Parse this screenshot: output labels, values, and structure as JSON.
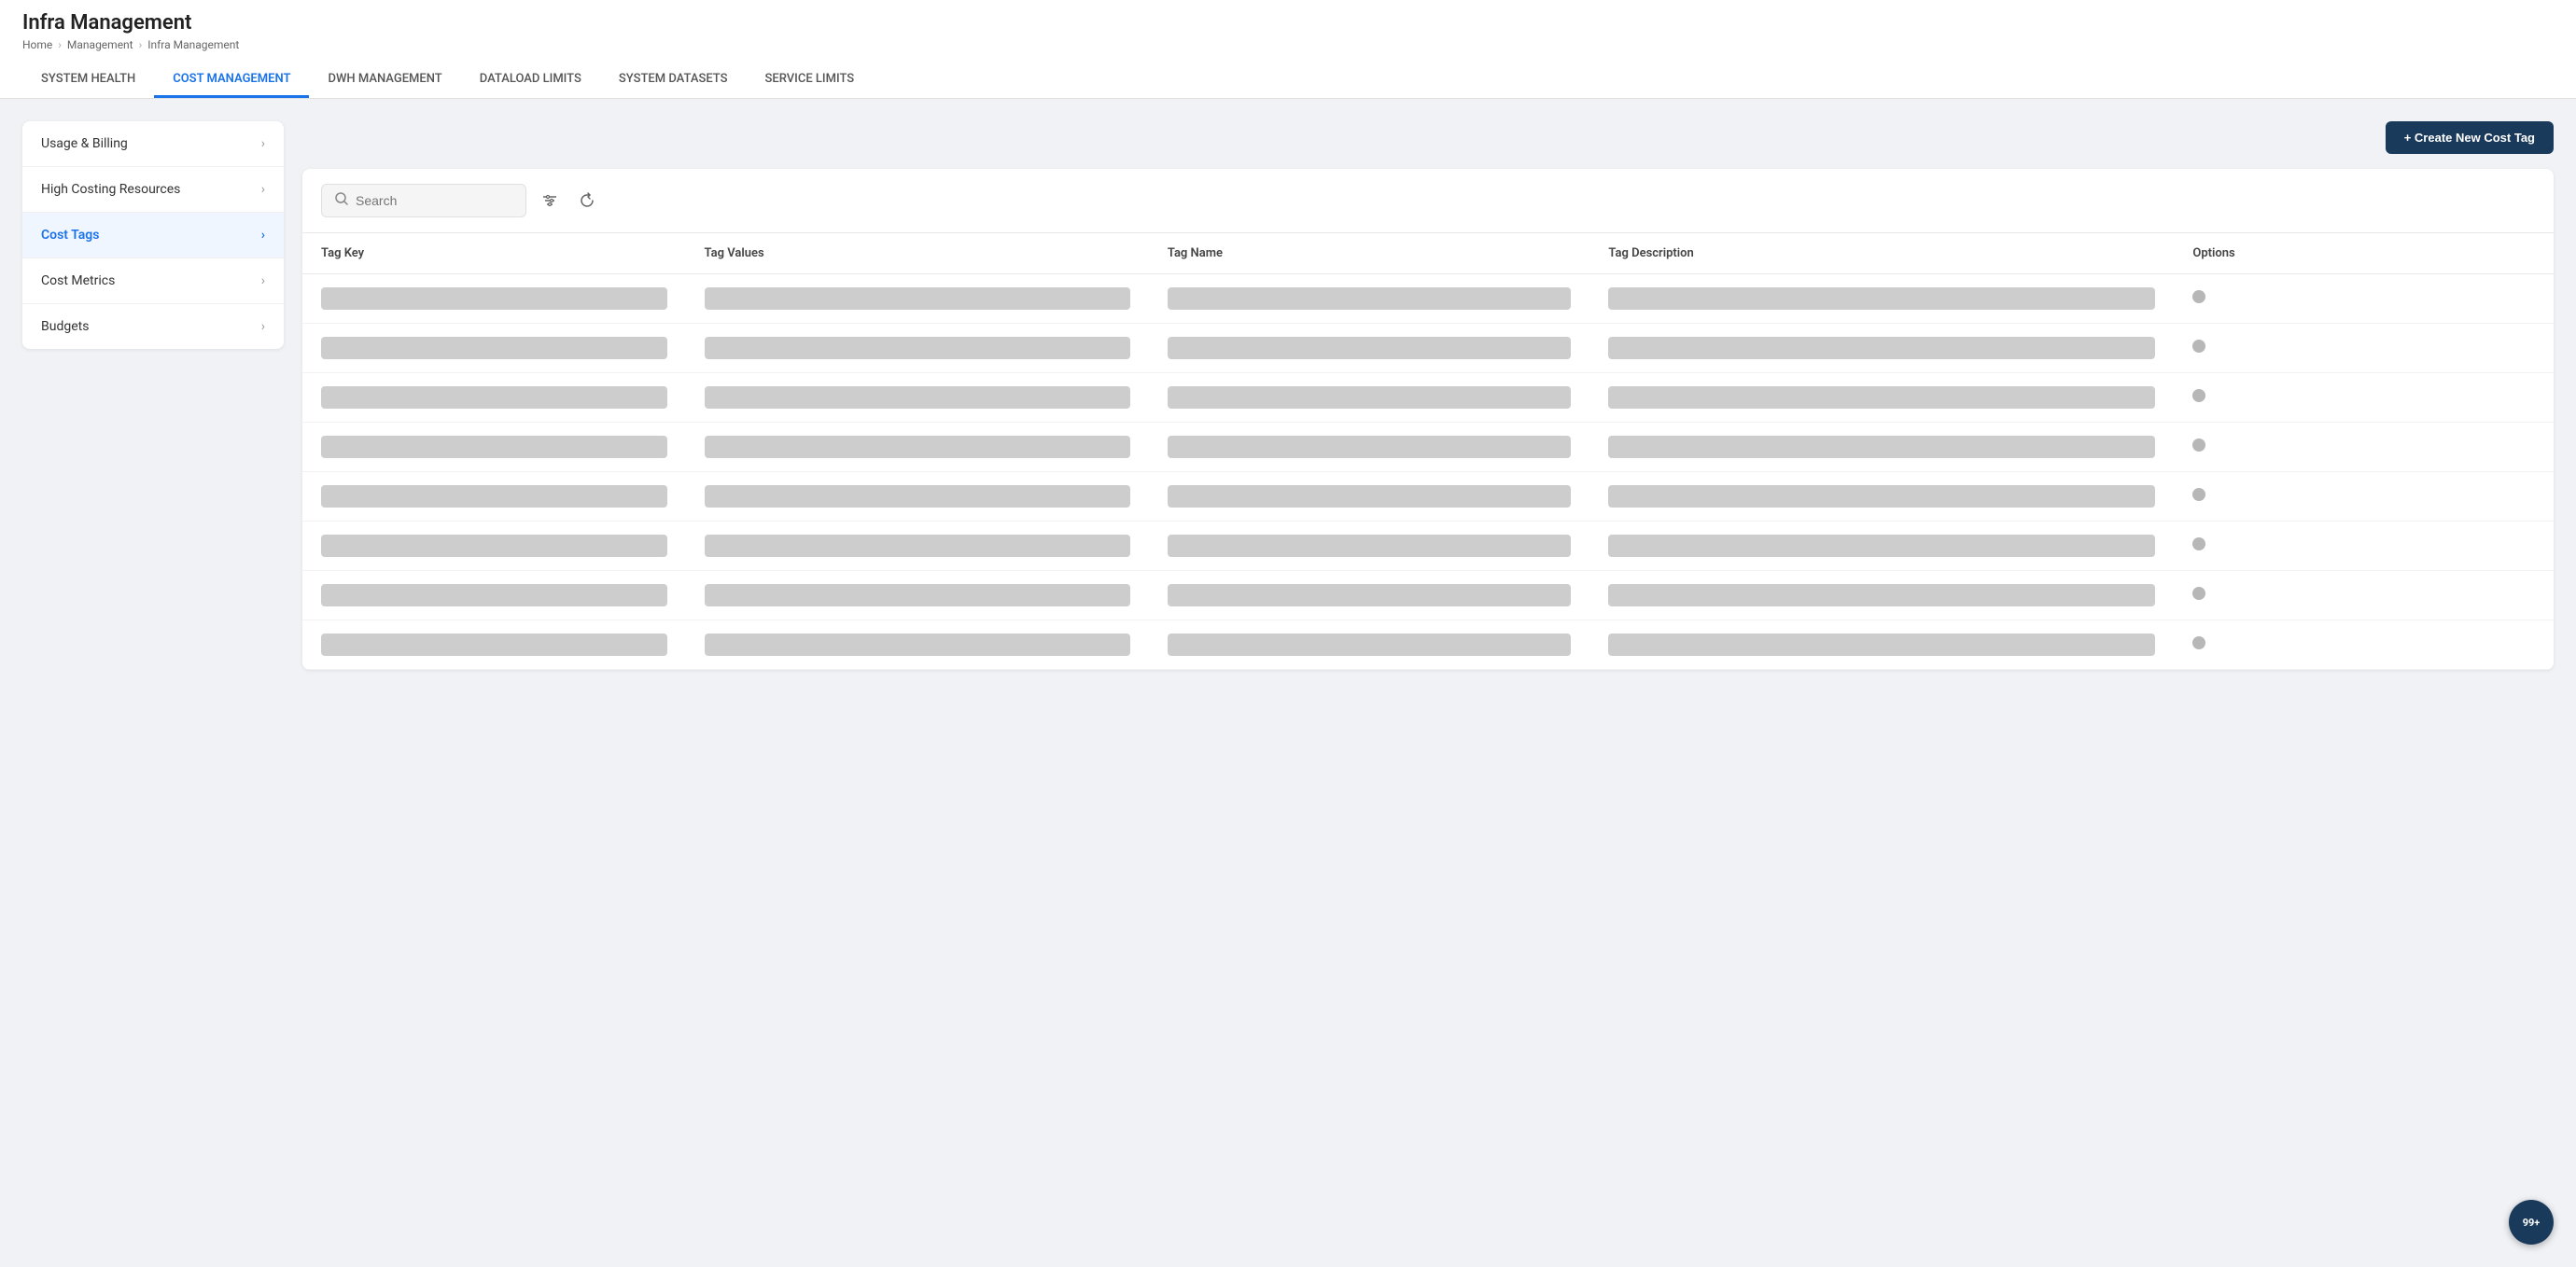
{
  "page": {
    "title": "Infra Management",
    "breadcrumbs": [
      "Home",
      "Management",
      "Infra Management"
    ]
  },
  "tabs": [
    {
      "id": "system-health",
      "label": "SYSTEM HEALTH",
      "active": false
    },
    {
      "id": "cost-management",
      "label": "COST MANAGEMENT",
      "active": true
    },
    {
      "id": "dwh-management",
      "label": "DWH MANAGEMENT",
      "active": false
    },
    {
      "id": "dataload-limits",
      "label": "DATALOAD LIMITS",
      "active": false
    },
    {
      "id": "system-datasets",
      "label": "SYSTEM DATASETS",
      "active": false
    },
    {
      "id": "service-limits",
      "label": "SERVICE LIMITS",
      "active": false
    }
  ],
  "sidebar": {
    "items": [
      {
        "id": "usage-billing",
        "label": "Usage & Billing",
        "active": false
      },
      {
        "id": "high-costing-resources",
        "label": "High Costing Resources",
        "active": false
      },
      {
        "id": "cost-tags",
        "label": "Cost Tags",
        "active": true
      },
      {
        "id": "cost-metrics",
        "label": "Cost Metrics",
        "active": false
      },
      {
        "id": "budgets",
        "label": "Budgets",
        "active": false
      }
    ]
  },
  "actions": {
    "create_button_label": "+ Create New Cost Tag"
  },
  "search": {
    "placeholder": "Search"
  },
  "table": {
    "columns": [
      "Tag Key",
      "Tag Values",
      "Tag Name",
      "Tag Description",
      "Options"
    ],
    "rows": [
      {
        "id": 1
      },
      {
        "id": 2
      },
      {
        "id": 3
      },
      {
        "id": 4
      },
      {
        "id": 5
      },
      {
        "id": 6
      },
      {
        "id": 7
      },
      {
        "id": 8
      }
    ]
  },
  "notification": {
    "badge": "99+"
  },
  "icons": {
    "chevron_right": "›",
    "search": "🔍",
    "filter": "⚙",
    "refresh": "↻",
    "plus": "+"
  }
}
